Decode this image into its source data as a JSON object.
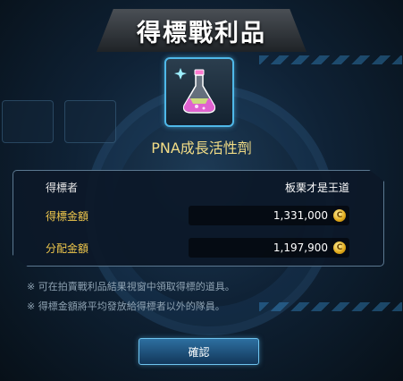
{
  "dialog": {
    "title": "得標戰利品",
    "item": {
      "name": "PNA成長活性劑",
      "icon": "pink-potion-flask-icon"
    },
    "rows": [
      {
        "label": "得標者",
        "value": "板栗才是王道"
      },
      {
        "label": "得標金額",
        "amount": "1,331,000"
      },
      {
        "label": "分配金額",
        "amount": "1,197,900"
      }
    ],
    "coin_glyph": "C",
    "notes": [
      "※ 可在拍賣戰利品結果視窗中領取得標的道具。",
      "※ 得標金額將平均發放給得標者以外的隊員。"
    ],
    "confirm_label": "確認"
  },
  "colors": {
    "accent": "#4fb8e8",
    "gold_label": "#f0c84c",
    "item_name": "#f2dc86",
    "note_text": "#8fa3b3"
  }
}
